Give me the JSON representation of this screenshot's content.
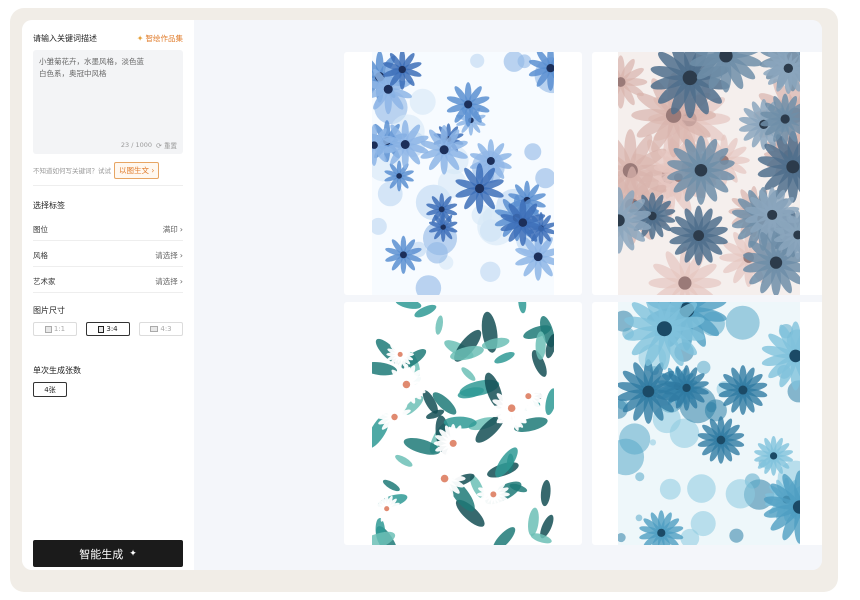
{
  "prompt": {
    "label": "请输入关键词描述",
    "gallery_link": "智绘作品集",
    "text": "小雏菊花卉，水墨风格，淡色蓝白色系，奥冠中风格",
    "char_count": "23 / 1000",
    "reset_label": "重置"
  },
  "hint": {
    "text": "不知道如何写关键词？试试",
    "image_to_text_label": "以图生文"
  },
  "tags": {
    "title": "选择标签",
    "items": [
      {
        "label": "图位",
        "value": "满印"
      },
      {
        "label": "风格",
        "value": "请选择"
      },
      {
        "label": "艺术家",
        "value": "请选择"
      }
    ]
  },
  "size": {
    "title": "图片尺寸",
    "options": [
      "1:1",
      "3:4",
      "4:3"
    ],
    "selected": "3:4"
  },
  "count": {
    "title": "单次生成张数",
    "value": "4张"
  },
  "generate_label": "智能生成",
  "images": [
    {
      "name": "blue-daisy-pattern",
      "palette": "blue-white"
    },
    {
      "name": "gray-blue-daisy-pattern",
      "palette": "gray-pink"
    },
    {
      "name": "teal-leaf-daisy-pattern",
      "palette": "teal-white"
    },
    {
      "name": "cyan-watercolor-daisy-pattern",
      "palette": "cyan-splash"
    }
  ],
  "colors": {
    "accent_orange": "#e07b2a",
    "button_dark": "#1b1b1b"
  }
}
